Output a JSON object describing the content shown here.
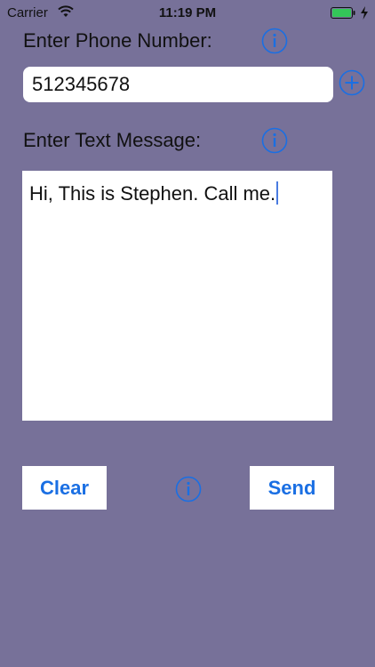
{
  "status_bar": {
    "carrier": "Carrier",
    "time": "11:19 PM"
  },
  "phone": {
    "label": "Enter Phone Number:",
    "value": "512345678"
  },
  "message": {
    "label": "Enter Text Message:",
    "value": "Hi, This is Stephen. Call me."
  },
  "buttons": {
    "clear_label": "Clear",
    "send_label": "Send"
  },
  "colors": {
    "background": "#777199",
    "accent": "#1a6fe3",
    "battery": "#34c759"
  },
  "icons": [
    "wifi-icon",
    "battery-icon",
    "charging-icon",
    "info-icon",
    "add-icon"
  ]
}
